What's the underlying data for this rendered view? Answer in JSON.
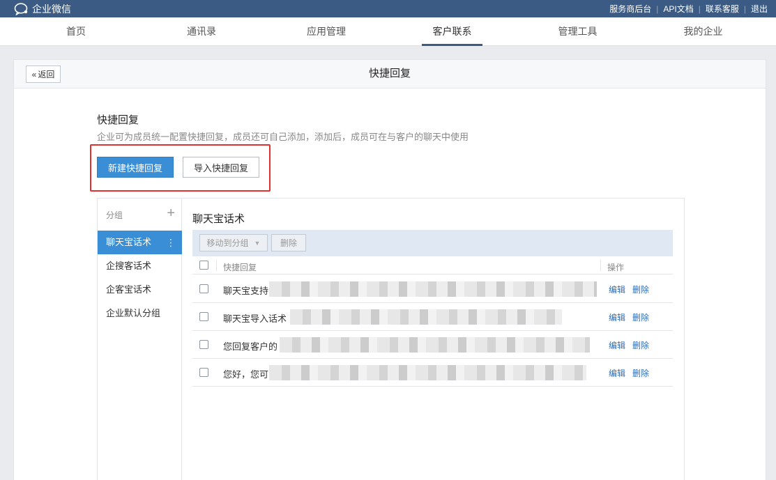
{
  "topbar": {
    "logo_text": "企业微信",
    "links": [
      "服务商后台",
      "API文档",
      "联系客服",
      "退出"
    ]
  },
  "nav": {
    "items": [
      "首页",
      "通讯录",
      "应用管理",
      "客户联系",
      "管理工具",
      "我的企业"
    ],
    "active": "客户联系"
  },
  "panel": {
    "back_label": "返回",
    "title": "快捷回复"
  },
  "section": {
    "title": "快捷回复",
    "desc": "企业可为成员统一配置快捷回复，成员还可自己添加，添加后，成员可在与客户的聊天中使用",
    "new_button": "新建快捷回复",
    "import_button": "导入快捷回复"
  },
  "groups": {
    "header": "分组",
    "items": [
      "聊天宝话术",
      "企搜客话术",
      "企客宝话术",
      "企业默认分组"
    ],
    "active": "聊天宝话术"
  },
  "list": {
    "title": "聊天宝话术",
    "move_button": "移动到分组",
    "delete_button": "删除",
    "col_reply": "快捷回复",
    "col_action": "操作",
    "rows": [
      {
        "text": "聊天宝支持",
        "edit": "编辑",
        "delete": "删除"
      },
      {
        "text": "聊天宝导入话术",
        "edit": "编辑",
        "delete": "删除"
      },
      {
        "text": "您回复客户的",
        "edit": "编辑",
        "delete": "删除"
      },
      {
        "text": "您好，您可",
        "edit": "编辑",
        "delete": "删除"
      }
    ]
  },
  "colors": {
    "topbar": "#3b5b84",
    "primary": "#3a8ed6",
    "highlight_border": "#e0312f",
    "link": "#2e6db4"
  }
}
